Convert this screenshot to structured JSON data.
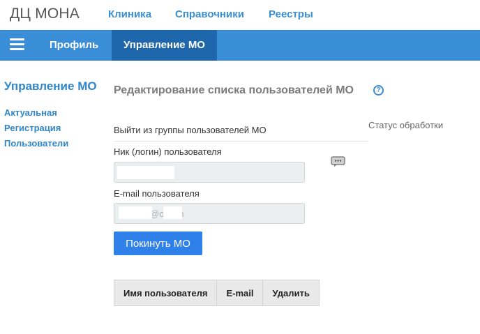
{
  "app": {
    "brand": "ДЦ МОНА",
    "top_nav": [
      "Клиника",
      "Справочники",
      "Реестры"
    ]
  },
  "navbar": {
    "menu_icon": "hamburger-icon",
    "tabs": [
      {
        "label": "Профиль",
        "active": false
      },
      {
        "label": "Управление МО",
        "active": true
      }
    ],
    "bar_color": "#3a8ed8",
    "active_color": "#1f67ac"
  },
  "sidebar": {
    "title": "Управление МО",
    "links": [
      "Актуальная",
      "Регистрация",
      "Пользователи"
    ]
  },
  "main": {
    "title": "Редактирование списка пользователей МО",
    "help_icon": "question-circle-icon",
    "status_label": "Статус обработки",
    "section_heading": "Выйти из группы пользователей МО",
    "nick_label": "Ник (логин) пользователя",
    "nick_value": "",
    "email_label": "E-mail пользователя",
    "email_value": "@o.com",
    "chat_icon": "comment-bubble-icon",
    "leave_button": "Покинуть МО",
    "table_headers": [
      "Имя пользователя",
      "E-mail",
      "Удалить"
    ],
    "accent_color": "#2f80e8"
  }
}
